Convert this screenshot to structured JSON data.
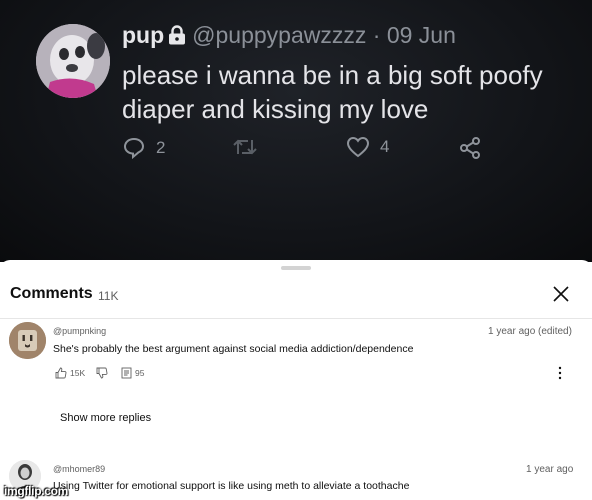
{
  "tweet": {
    "display_name": "pup",
    "handle": "@puppypawzzzz",
    "separator": "·",
    "date": "09 Jun",
    "text": "please i wanna be in a big soft poofy diaper and kissing my love",
    "reply_count": "2",
    "like_count": "4",
    "icons": [
      "lock-icon",
      "reply-icon",
      "retweet-icon",
      "like-icon",
      "share-icon"
    ]
  },
  "comments_panel": {
    "title": "Comments",
    "count": "11K",
    "icons": [
      "close-icon"
    ]
  },
  "comments": [
    {
      "username": "@pumpnking",
      "time": "1 year ago (edited)",
      "text": "She's probably the best argument against social media addiction/dependence",
      "likes": "15K",
      "replies": "95",
      "show_more": "Show more replies"
    },
    {
      "username": "@mhomer89",
      "time": "1 year ago",
      "text": "Using Twitter for emotional support is like using meth to alleviate a toothache"
    }
  ],
  "watermark": "imgflip.com",
  "colors": {
    "tweet_background": "#121418",
    "tweet_text": "#e4e4e8",
    "tweet_muted": "#8b9098",
    "sheet_background": "#ffffff",
    "secondary_text": "#606060"
  }
}
